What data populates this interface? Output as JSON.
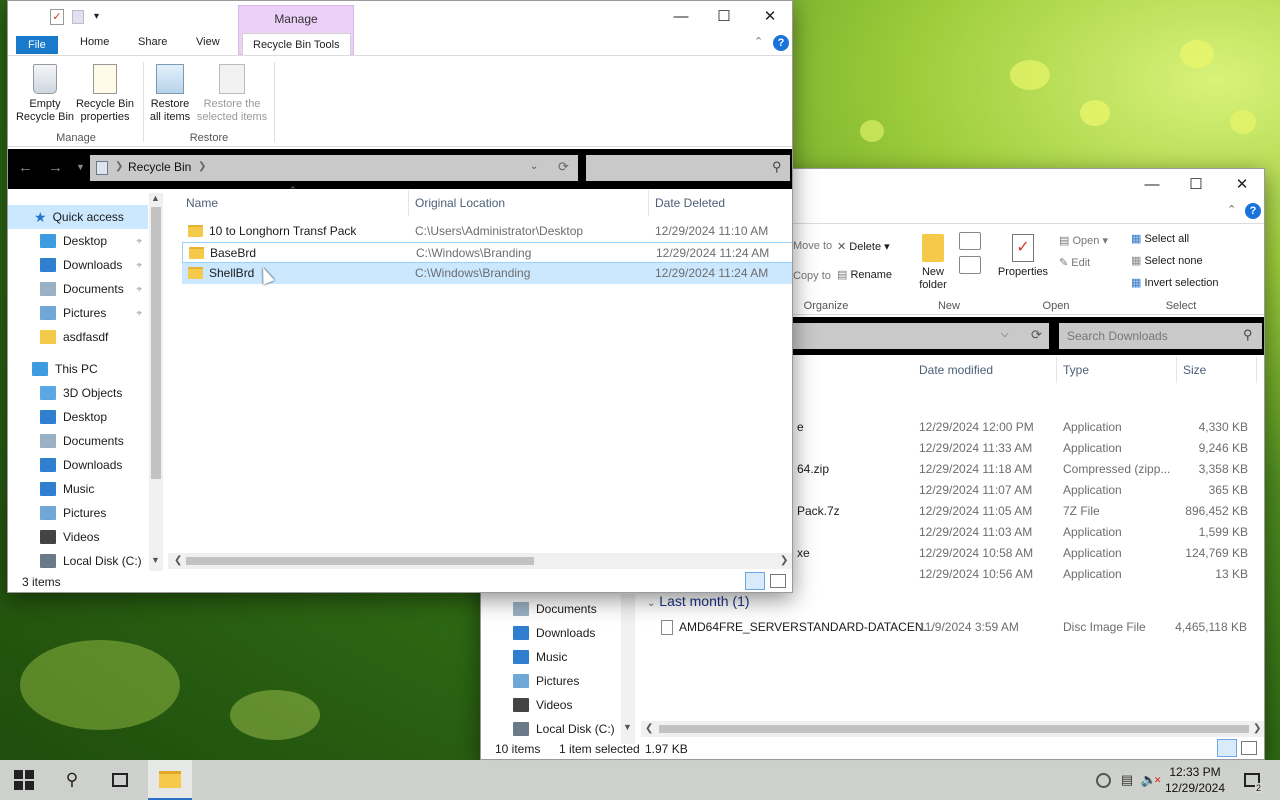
{
  "colors": {
    "manage_tab": "#ecd0f7",
    "selected_row": "#cce8ff",
    "address_bar_bg": "#c9c9c9",
    "taskbar": "#d7d7d7",
    "folder": "#f5c94a"
  },
  "recycle": {
    "manage_label": "Manage",
    "tabs": [
      "File",
      "Home",
      "Share",
      "View",
      "Recycle Bin Tools"
    ],
    "ribbon": {
      "empty": "Empty Recycle Bin",
      "props": "Recycle Bin properties",
      "restore_all": "Restore all items",
      "restore_sel": "Restore the selected items",
      "group_manage": "Manage",
      "group_restore": "Restore"
    },
    "address": {
      "path": "Recycle Bin"
    },
    "nav": {
      "quick_access": "Quick access",
      "quick_items": [
        "Desktop",
        "Downloads",
        "Documents",
        "Pictures",
        "asdfasdf"
      ],
      "this_pc": "This PC",
      "pc_items": [
        "3D Objects",
        "Desktop",
        "Documents",
        "Downloads",
        "Music",
        "Pictures",
        "Videos",
        "Local Disk (C:)"
      ]
    },
    "columns": {
      "name": "Name",
      "orig": "Original Location",
      "date": "Date Deleted"
    },
    "rows": [
      {
        "name": "10 to Longhorn Transf Pack",
        "orig": "C:\\Users\\Administrator\\Desktop",
        "date": "12/29/2024 11:10 AM"
      },
      {
        "name": "BaseBrd",
        "orig": "C:\\Windows\\Branding",
        "date": "12/29/2024 11:24 AM"
      },
      {
        "name": "ShellBrd",
        "orig": "C:\\Windows\\Branding",
        "date": "12/29/2024 11:24 AM"
      }
    ],
    "status": {
      "count": "3 items"
    }
  },
  "downloads": {
    "ribbon": {
      "move_to": "Move to",
      "copy_to": "Copy to",
      "delete": "Delete",
      "rename": "Rename",
      "group_organize": "Organize",
      "new_folder": "New folder",
      "group_new": "New",
      "properties": "Properties",
      "open": "Open",
      "edit": "Edit",
      "group_open": "Open",
      "select_all": "Select all",
      "select_none": "Select none",
      "invert": "Invert selection",
      "group_select": "Select"
    },
    "search_placeholder": "Search Downloads",
    "columns": {
      "modified": "Date modified",
      "type": "Type",
      "size": "Size"
    },
    "rows": [
      {
        "name": "e",
        "modified": "12/29/2024 12:00 PM",
        "type": "Application",
        "size": "4,330 KB"
      },
      {
        "name": "",
        "modified": "12/29/2024 11:33 AM",
        "type": "Application",
        "size": "9,246 KB"
      },
      {
        "name": "64.zip",
        "modified": "12/29/2024 11:18 AM",
        "type": "Compressed (zipp...",
        "size": "3,358 KB"
      },
      {
        "name": "",
        "modified": "12/29/2024 11:07 AM",
        "type": "Application",
        "size": "365 KB"
      },
      {
        "name": "Pack.7z",
        "modified": "12/29/2024 11:05 AM",
        "type": "7Z File",
        "size": "896,452 KB"
      },
      {
        "name": "",
        "modified": "12/29/2024 11:03 AM",
        "type": "Application",
        "size": "1,599 KB"
      },
      {
        "name": "xe",
        "modified": "12/29/2024 10:58 AM",
        "type": "Application",
        "size": "124,769 KB"
      },
      {
        "name": "",
        "modified": "12/29/2024 10:56 AM",
        "type": "Application",
        "size": "13 KB"
      }
    ],
    "group_last_month": "Last month (1)",
    "last_row": {
      "name": "AMD64FRE_SERVERSTANDARD-DATACEN...",
      "modified": "11/9/2024 3:59 AM",
      "type": "Disc Image File",
      "size": "4,465,118 KB"
    },
    "nav_items": [
      "Documents",
      "Downloads",
      "Music",
      "Pictures",
      "Videos",
      "Local Disk (C:)"
    ],
    "status": {
      "count": "10 items",
      "selected": "1 item selected",
      "size": "1.97 KB"
    }
  },
  "taskbar": {
    "time": "12:33 PM",
    "date": "12/29/2024",
    "notif_count": "2"
  }
}
